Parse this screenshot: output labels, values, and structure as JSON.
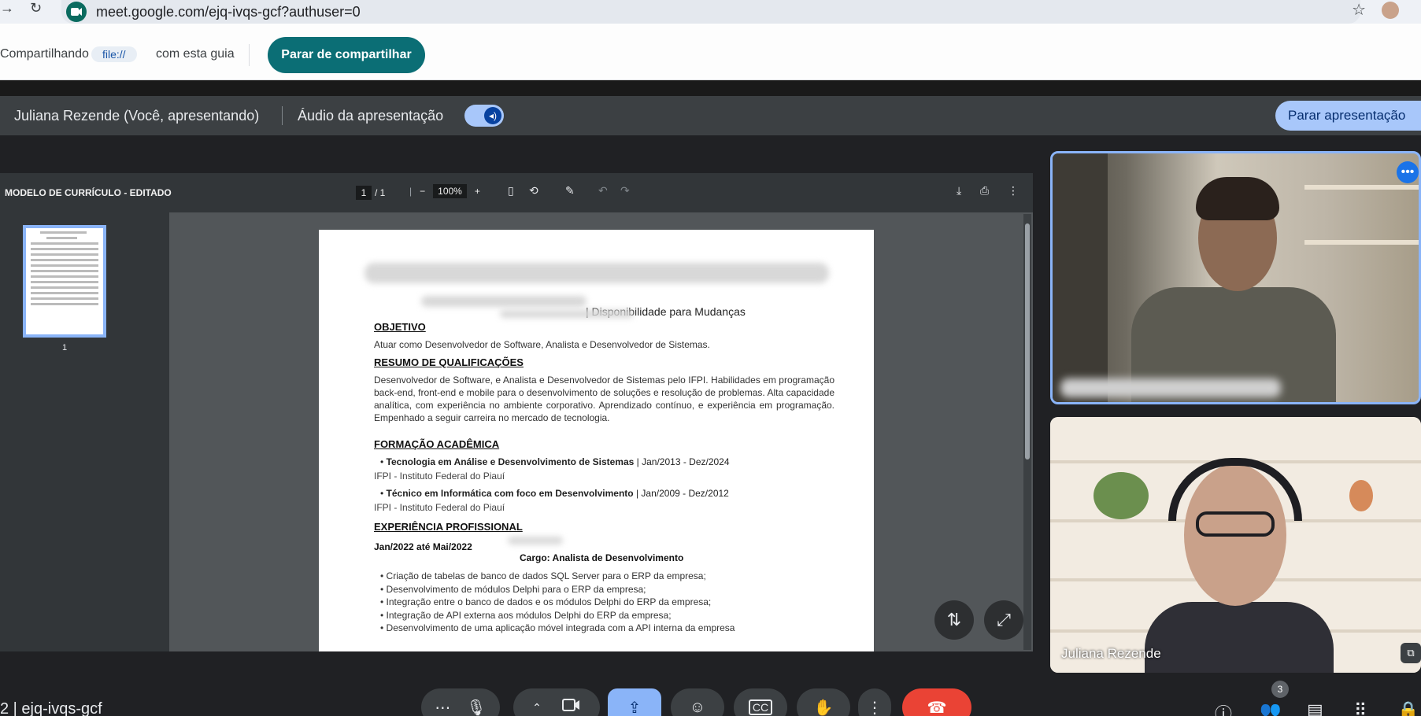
{
  "browser": {
    "url": "meet.google.com/ejq-ivqs-gcf?authuser=0"
  },
  "share_bar": {
    "prefix": "Compartilhando",
    "chip": "file://",
    "suffix": "com esta guia",
    "stop_button": "Parar de compartilhar"
  },
  "presentation_bar": {
    "presenter": "Juliana Rezende (Você, apresentando)",
    "audio_label": "Áudio da apresentação",
    "stop_button": "Parar apresentação"
  },
  "pdf": {
    "title": "MODELO DE CURRÍCULO - EDITADO",
    "page_current": "1",
    "page_total": "/ 1",
    "zoom": "100%",
    "thumb_page": "1",
    "subtitle": "| Disponibilidade para Mudanças",
    "sections": {
      "objetivo_heading": "OBJETIVO",
      "objetivo_text": "Atuar como Desenvolvedor de Software, Analista e Desenvolvedor de Sistemas.",
      "resumo_heading": "RESUMO DE QUALIFICAÇÕES",
      "resumo_text": "Desenvolvedor de Software, e Analista e Desenvolvedor de Sistemas pelo IFPI. Habilidades em programação back-end, front-end e mobile para o desenvolvimento de soluções e resolução de problemas. Alta capacidade analítica, com experiência no ambiente corporativo. Aprendizado contínuo, e experiência em programação. Empenhado a seguir carreira no mercado de tecnologia.",
      "formacao_heading": "FORMAÇÃO ACADÊMICA",
      "course1_name": "Tecnologia em Análise e Desenvolvimento de Sistemas",
      "course1_dates": " | Jan/2013 - Dez/2024",
      "course1_inst": "IFPI - Instituto Federal do Piauí",
      "course2_name": "Técnico em Informática com foco em Desenvolvimento",
      "course2_dates": " | Jan/2009 - Dez/2012",
      "course2_inst": "IFPI - Instituto Federal do Piauí",
      "experiencia_heading": "EXPERIÊNCIA PROFISSIONAL",
      "exp_period": "Jan/2022 até Mai/2022",
      "exp_role": "Cargo: Analista de Desenvolvimento",
      "exp_items": [
        "Criação de tabelas de banco de dados SQL Server para o ERP da empresa;",
        "Desenvolvimento de módulos Delphi para o ERP da empresa;",
        "Integração entre o banco de dados e os módulos Delphi do ERP da empresa;",
        "Integração de API externa aos módulos Delphi do ERP da empresa;",
        "Desenvolvimento de uma aplicação móvel integrada com a API interna da empresa"
      ]
    }
  },
  "tiles": {
    "participant_2_name": "Juliana Rezende"
  },
  "controls": {
    "meeting_code": "2 | ejq-ivqs-gcf",
    "people_count": "3"
  },
  "colors": {
    "accent": "#8ab4f8",
    "share_button": "#0b6e75",
    "end_call": "#ea4335"
  }
}
